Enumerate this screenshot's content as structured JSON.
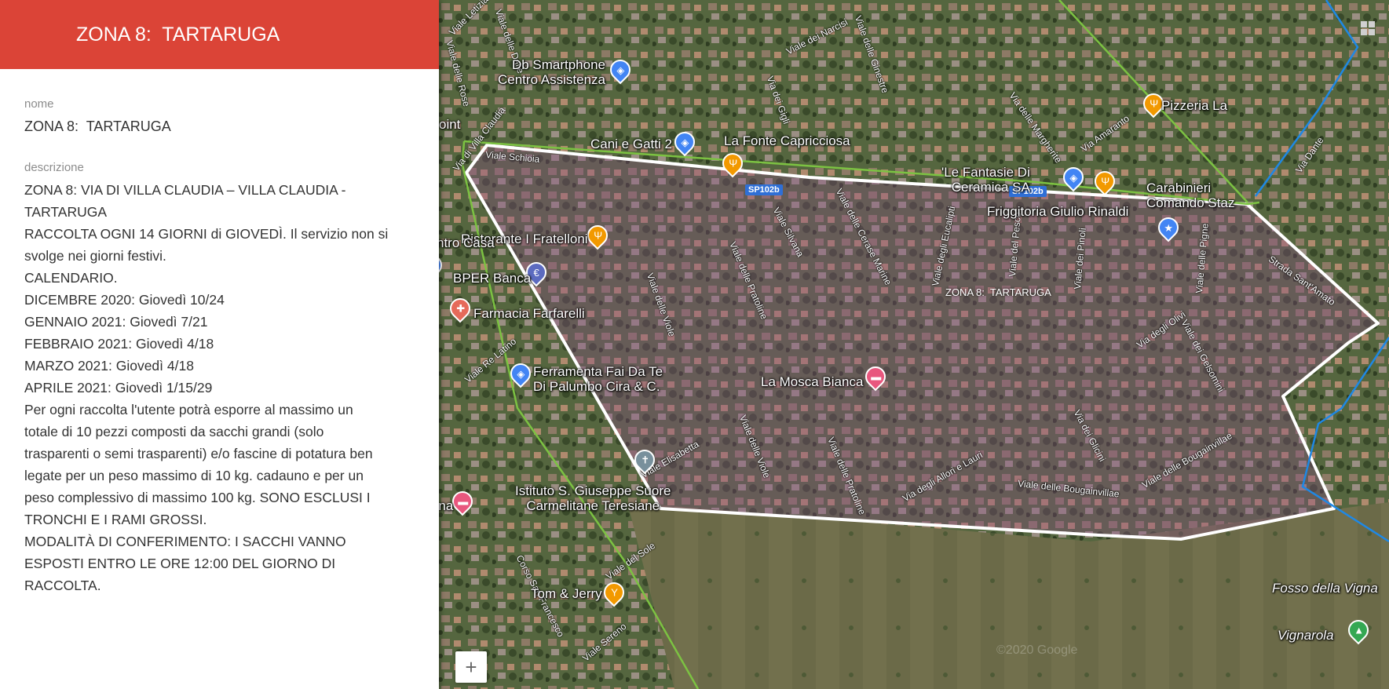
{
  "panel": {
    "title": "ZONA 8:  TARTARUGA",
    "name_label": "nome",
    "name_value": "ZONA 8:  TARTARUGA",
    "description_label": "descrizione",
    "description_lines": [
      "ZONA 8: VIA DI VILLA CLAUDIA – VILLA CLAUDIA -",
      "TARTARUGA",
      "RACCOLTA OGNI 14 GIORNI di GIOVEDÌ. Il servizio non si",
      "svolge nei giorni festivi.",
      "CALENDARIO.",
      "DICEMBRE 2020: Giovedì 10/24",
      "GENNAIO 2021: Giovedì 7/21",
      "FEBBRAIO 2021: Giovedì 4/18",
      "MARZO 2021: Giovedì 4/18",
      "APRILE 2021: Giovedì 1/15/29",
      "Per ogni raccolta l'utente potrà esporre al massimo un",
      "totale di 10 pezzi composti da sacchi grandi (solo",
      "trasparenti o semi trasparenti) e/o fascine di potatura ben",
      "legate per un peso massimo di 10 kg. cadauno e per un",
      "peso complessivo di massimo 100 kg. SONO ESCLUSI I",
      "TRONCHI E I RAMI GROSSI.",
      "MODALITÀ DI CONFERIMENTO: I SACCHI VANNO",
      "ESPOSTI ENTRO LE ORE 12:00 DEL GIORNO DI",
      "RACCOLTA."
    ]
  },
  "map": {
    "zone_label": "ZONA 8:  TARTARUGA",
    "zoom_in": "+",
    "watermark": "©2020 Google",
    "colors": {
      "zone_outline": "#ffffff",
      "zone_fill": "#8a4a8a",
      "green_line": "#7cc242",
      "blue_line": "#1e88e5",
      "header": "#db4437"
    },
    "places": [
      {
        "id": "db-smartphone",
        "text": "Db Smartphone\nCentro Assistenza",
        "icon": "shopping-icon",
        "color": "#4285f4"
      },
      {
        "id": "cani-gatti",
        "text": "Cani e Gatti 2",
        "icon": "shopping-icon",
        "color": "#4285f4"
      },
      {
        "id": "la-fonte",
        "text": "La Fonte Capricciosa",
        "icon": "restaurant-icon",
        "color": "#f29900"
      },
      {
        "id": "le-fantasie",
        "text": "'Le Fantasie Di\nCeramica SA",
        "icon": "shopping-icon",
        "color": "#4285f4"
      },
      {
        "id": "pizzeria",
        "text": "Pizzeria La",
        "icon": "restaurant-icon",
        "color": "#f29900"
      },
      {
        "id": "carabinieri",
        "text": "Carabinieri\nComando Staz",
        "icon": "police-icon",
        "color": "#4285f4"
      },
      {
        "id": "friggitoria",
        "text": "Friggitoria Giulio Rinaldi",
        "icon": "restaurant-icon",
        "color": "#f29900"
      },
      {
        "id": "ristorante",
        "text": "Ristorante I Fratelloni",
        "icon": "restaurant-icon",
        "color": "#f29900"
      },
      {
        "id": "bper",
        "text": "BPER Banca",
        "icon": "bank-icon",
        "color": "#5c6bc0"
      },
      {
        "id": "farmacia",
        "text": "Farmacia Farfarelli",
        "icon": "pharmacy-icon",
        "color": "#e66a5a"
      },
      {
        "id": "ferramenta",
        "text": "Ferramenta Fai Da Te\nDi Palumbo Cira & C.",
        "icon": "shopping-icon",
        "color": "#4285f4"
      },
      {
        "id": "la-mosca",
        "text": "La Mosca Bianca",
        "icon": "hotel-icon",
        "color": "#e8577e"
      },
      {
        "id": "istituto",
        "text": "Istituto S. Giuseppe Suore\nCarmelitane Teresiane",
        "icon": "church-icon",
        "color": "#78909c"
      },
      {
        "id": "villa-anna",
        "text": "Villa Anna",
        "icon": "hotel-icon",
        "color": "#e8577e"
      },
      {
        "id": "tom-jerry",
        "text": "Tom & Jerry",
        "icon": "bar-icon",
        "color": "#f29900"
      },
      {
        "id": "fosso",
        "text": "Fosso della Vigna",
        "icon": "",
        "color": ""
      },
      {
        "id": "vignarola",
        "text": "Vignarola",
        "icon": "park-icon",
        "color": "#34a853"
      },
      {
        "id": "centro-casa",
        "text": "ntro Casa",
        "icon": "shopping-icon",
        "color": "#4285f4"
      },
      {
        "id": "oint",
        "text": "oint",
        "icon": "shopping-icon",
        "color": "#4285f4"
      }
    ],
    "streets": [
      "Viale Letizia",
      "Viale delle Dalie",
      "Viale delle Rose",
      "Viale dei Narcisi",
      "Viale delle Ginestre",
      "Via dei Gigli",
      "Via delle Margherite",
      "Via Amaranto",
      "Viale Schioia",
      "Viale delle Cerase Marine",
      "Viale Silvana",
      "Viale delle Pratoline",
      "Viale delle Viole",
      "Viale degli Eucalipti",
      "Viale del Pesco",
      "Viale dei Pinoli",
      "Viale delle Pigne",
      "Via degli Olivi",
      "Viale dei Gelsomini",
      "Via Dante",
      "Strada Sant'Amato",
      "Viale Re Latino",
      "Viale Elisabetta",
      "Via degli Allori e Lauri",
      "Viale delle Bougainvillae",
      "Via dei Glicini",
      "Viale del Sole",
      "Corso San Francesco",
      "Viale Sereno",
      "Via di Villa Claudia"
    ],
    "road_shields": [
      "SP102b",
      "SP102b"
    ]
  }
}
